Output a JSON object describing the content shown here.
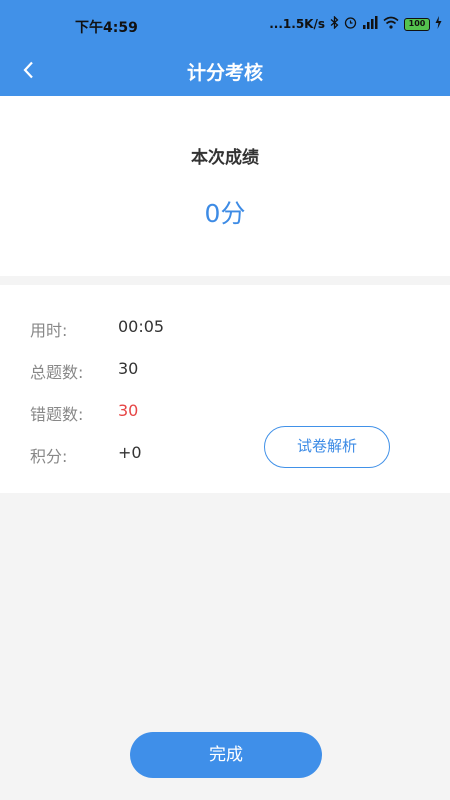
{
  "status_bar": {
    "time": "下午4:59",
    "net_speed": "...1.5K/s",
    "battery": "100"
  },
  "header": {
    "title": "计分考核"
  },
  "score": {
    "label": "本次成绩",
    "value": "0分"
  },
  "details": {
    "time_label": "用时:",
    "time_value": "00:05",
    "total_label": "总题数:",
    "total_value": "30",
    "wrong_label": "错题数:",
    "wrong_value": "30",
    "points_label": "积分:",
    "points_value": "+0"
  },
  "buttons": {
    "review": "试卷解析",
    "finish": "完成"
  },
  "colors": {
    "primary": "#4191e8",
    "error": "#e64646"
  }
}
